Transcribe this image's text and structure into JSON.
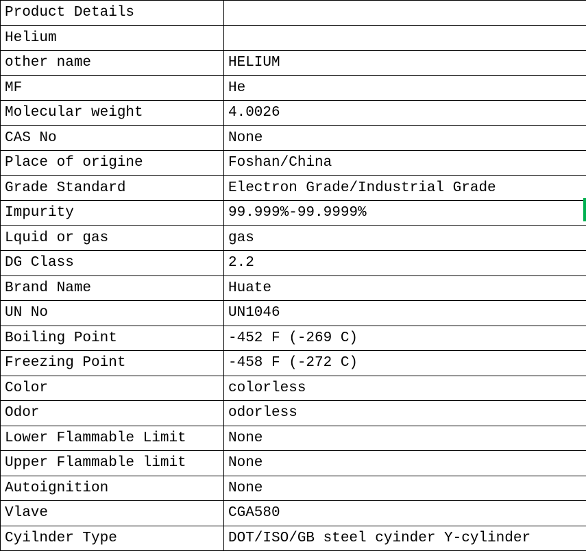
{
  "rows": [
    {
      "label": "Product Details",
      "value": ""
    },
    {
      "label": "Helium",
      "value": ""
    },
    {
      "label": "other name",
      "value": "HELIUM"
    },
    {
      "label": "MF",
      "value": "He"
    },
    {
      "label": "Molecular weight",
      "value": "4.0026"
    },
    {
      "label": "CAS No",
      "value": "None"
    },
    {
      "label": "Place of origine",
      "value": "Foshan/China"
    },
    {
      "label": "Grade Standard",
      "value": "Electron Grade/Industrial Grade"
    },
    {
      "label": "Impurity",
      "value": "99.999%-99.9999%"
    },
    {
      "label": "Lquid or gas",
      "value": "gas"
    },
    {
      "label": "DG Class",
      "value": "2.2"
    },
    {
      "label": "Brand Name",
      "value": "Huate"
    },
    {
      "label": "UN No",
      "value": "UN1046"
    },
    {
      "label": "Boiling Point",
      "value": "-452 F (-269 C)"
    },
    {
      "label": "Freezing Point",
      "value": " -458 F (-272 C)"
    },
    {
      "label": "Color",
      "value": " colorless"
    },
    {
      "label": "Odor",
      "value": "odorless"
    },
    {
      "label": "Lower Flammable Limit",
      "value": "None"
    },
    {
      "label": "Upper Flammable limit",
      "value": "None"
    },
    {
      "label": "Autoignition",
      "value": "None"
    },
    {
      "label": "Vlave",
      "value": "CGA580"
    },
    {
      "label": "Cyilnder Type",
      "value": "DOT/ISO/GB steel cyinder  Y-cylinder"
    }
  ]
}
